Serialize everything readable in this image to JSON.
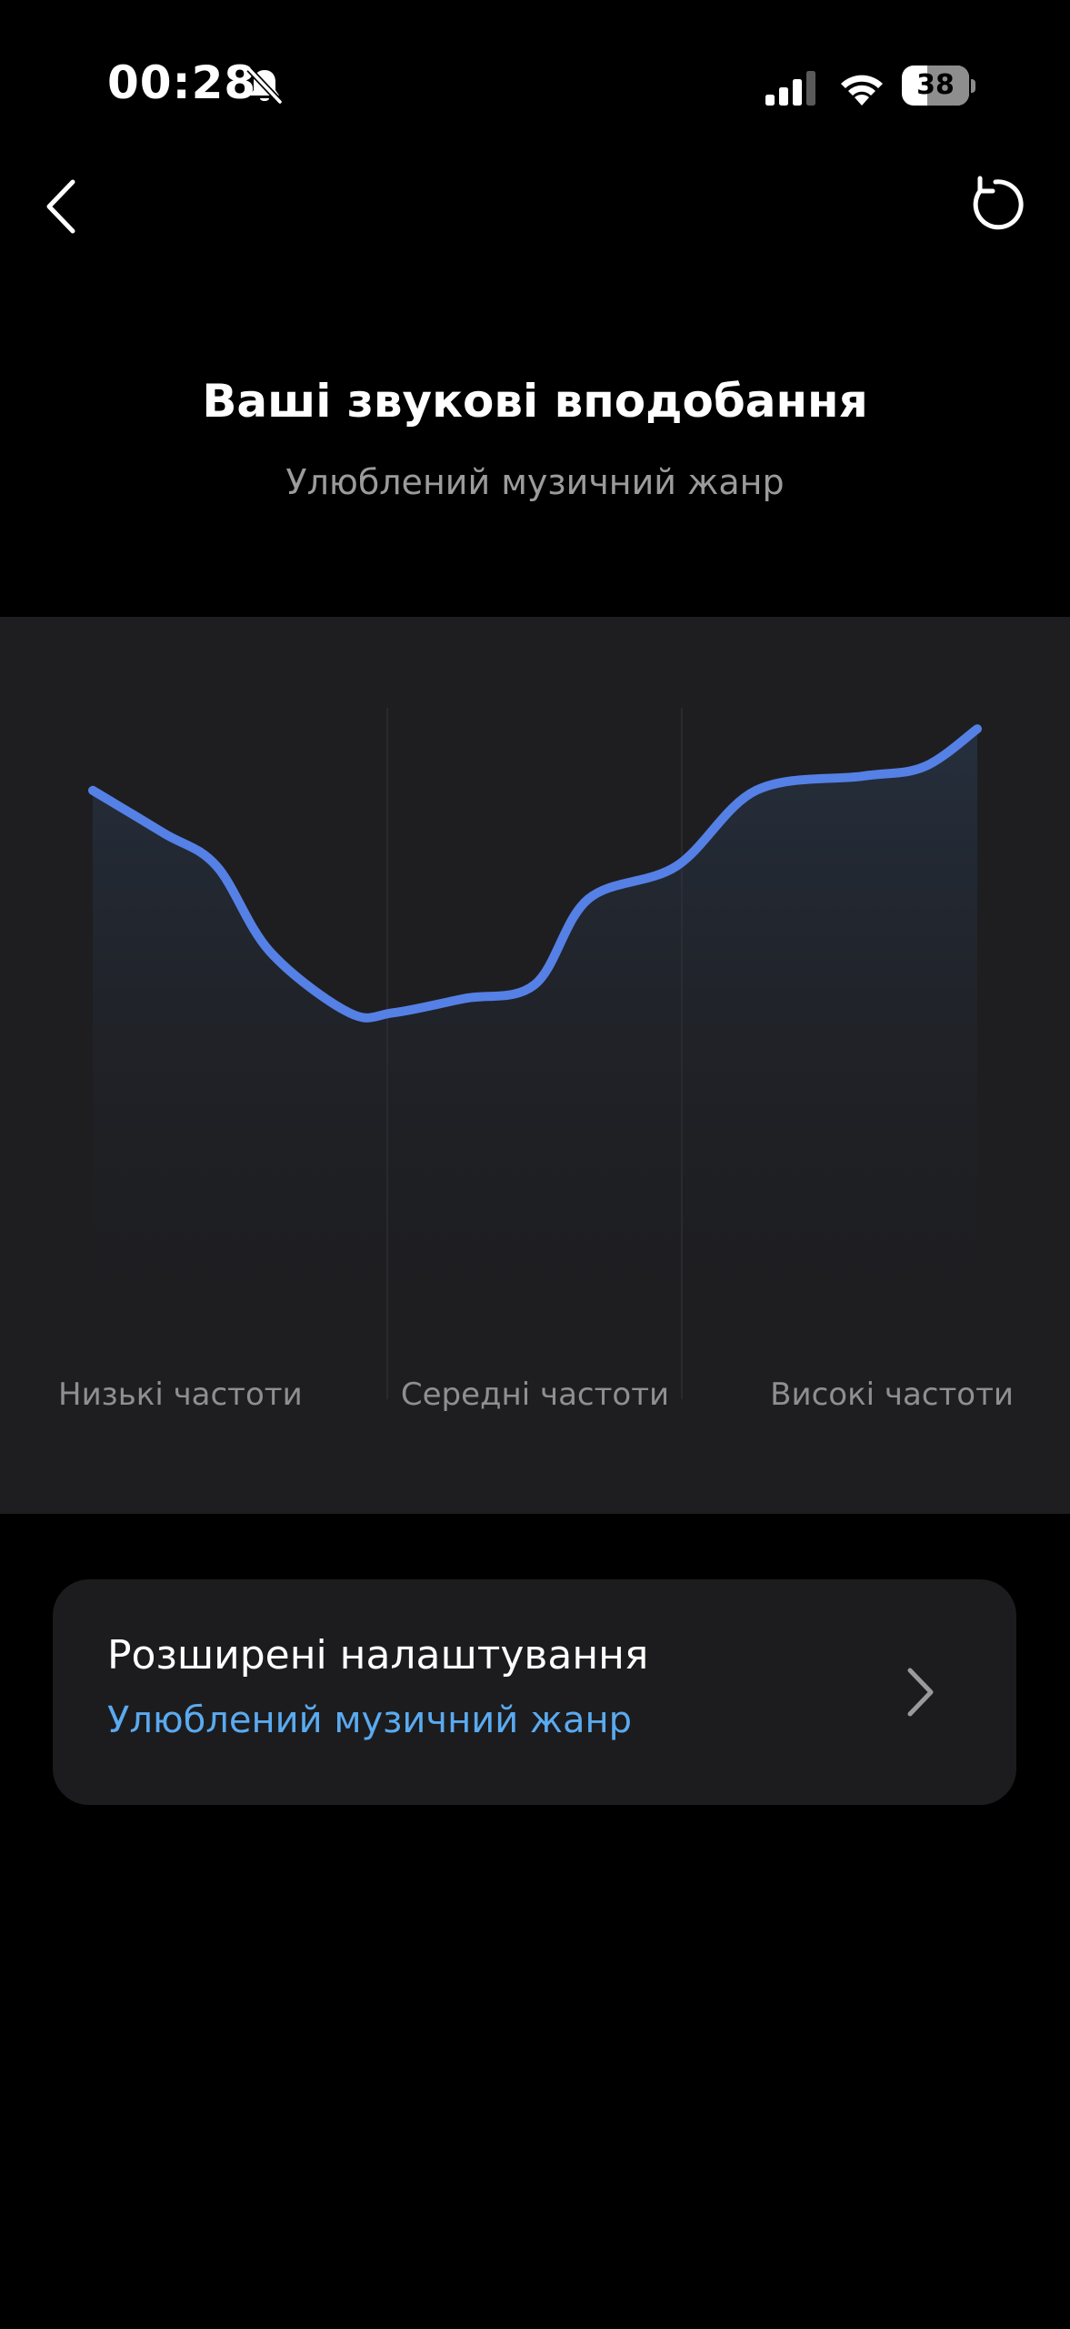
{
  "status_bar": {
    "time": "00:28",
    "battery_level": "38",
    "icons": [
      "bell-slash-icon",
      "cellular-signal-icon",
      "wifi-icon",
      "battery-icon"
    ]
  },
  "nav": {
    "back_icon": "chevron-left-icon",
    "reset_icon": "rotate-ccw-icon"
  },
  "header": {
    "title": "Ваші звукові вподобання",
    "subtitle": "Улюблений музичний жанр"
  },
  "eq_chart": {
    "bands": [
      "Низькі частоти",
      "Середні частоти",
      "Високі частоти"
    ],
    "curve_color": "#5580e6",
    "background_color": "#1e1e21"
  },
  "chart_data": {
    "type": "line",
    "title": "",
    "xlabel": "",
    "ylabel": "",
    "categories": [
      "Низькі частоти",
      "Середні частоти",
      "Високі частоти"
    ],
    "grid": "vertical band dividers",
    "series": [
      {
        "x": [
          0,
          0.08,
          0.14,
          0.2,
          0.29,
          0.34,
          0.42,
          0.5,
          0.56,
          0.66,
          0.75,
          0.87,
          0.94,
          1.0
        ],
        "values": [
          0.71,
          0.62,
          0.55,
          0.37,
          0.24,
          0.24,
          0.27,
          0.3,
          0.48,
          0.55,
          0.71,
          0.74,
          0.76,
          0.84
        ]
      }
    ],
    "ylim": [
      0,
      1
    ]
  },
  "settings_card": {
    "title": "Розширені налаштування",
    "value": "Улюблений музичний жанр",
    "chevron_icon": "chevron-right-icon"
  },
  "colors": {
    "background": "#000000",
    "panel": "#1e1e21",
    "card": "#1c1c1e",
    "accent_blue": "#5aaaf0",
    "curve_blue": "#5580e6",
    "muted_text": "#9b9b9b"
  }
}
